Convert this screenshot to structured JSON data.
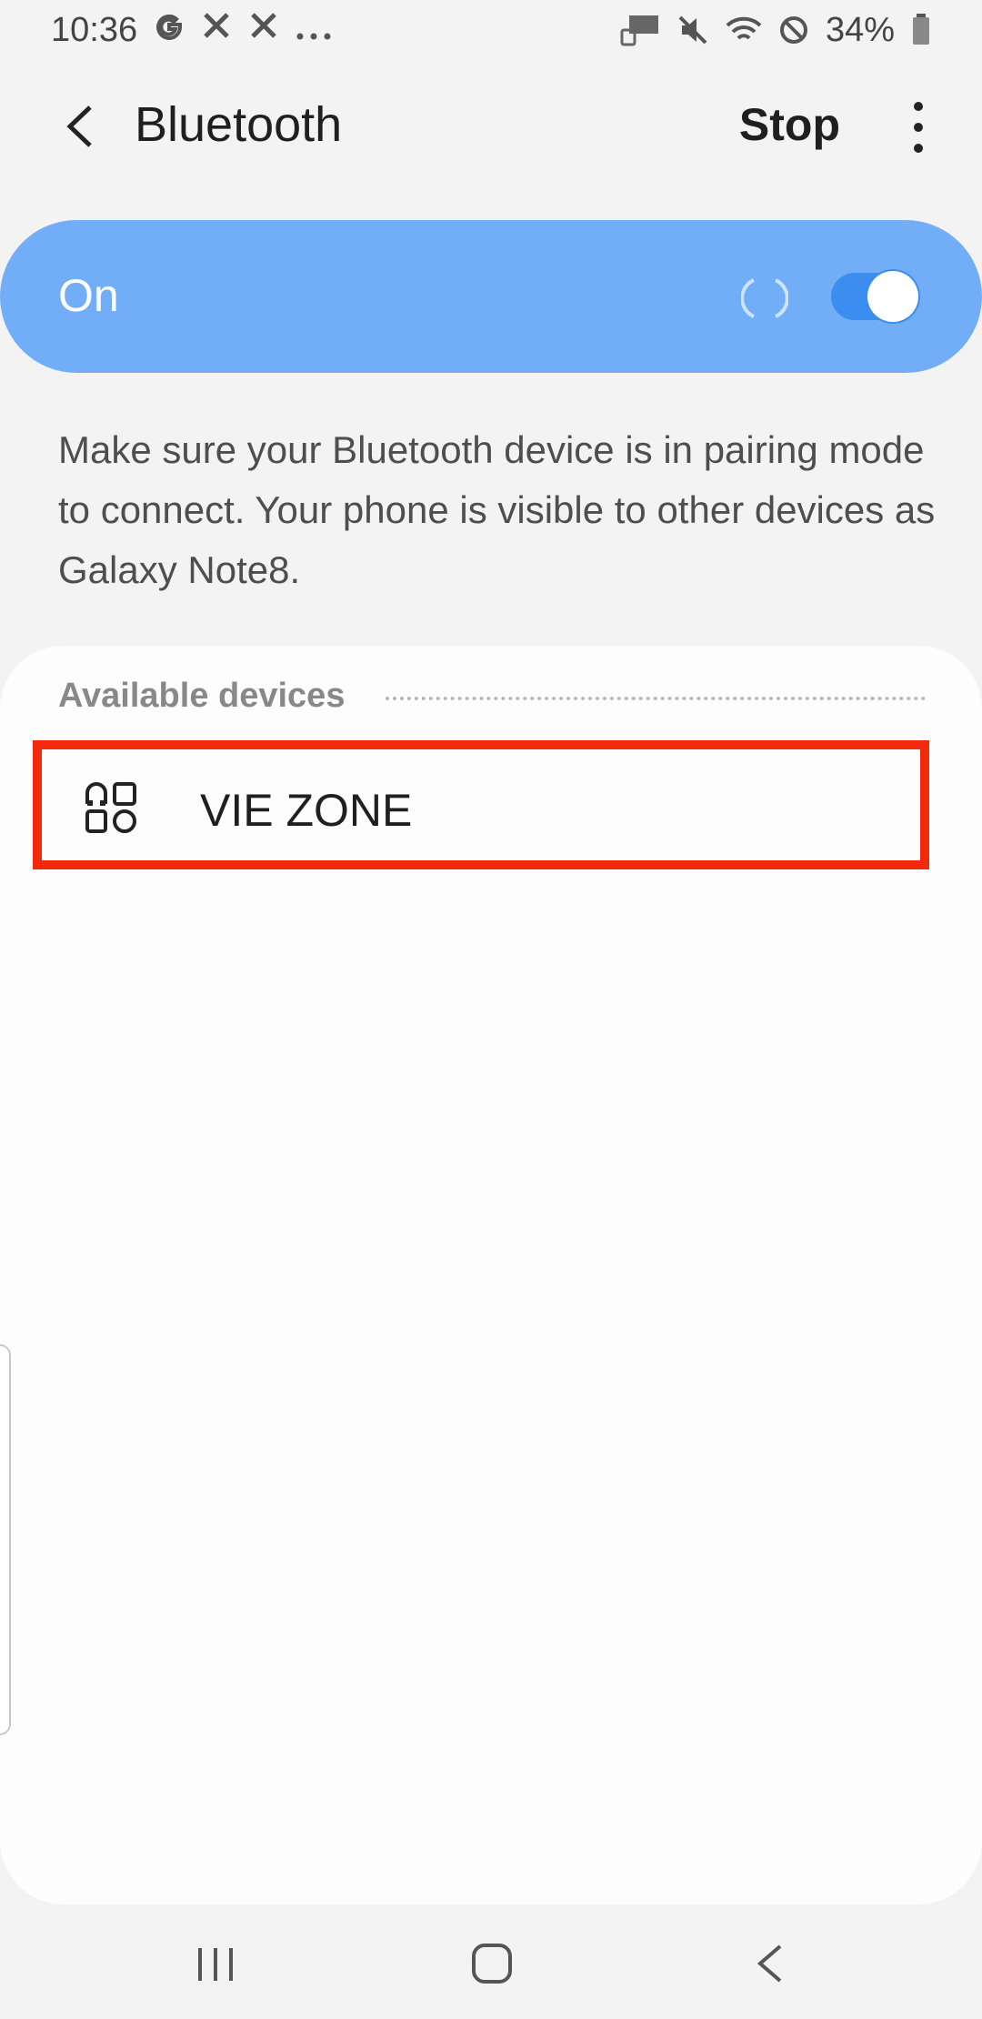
{
  "status_bar": {
    "time": "10:36",
    "left_icons": [
      "google-g-icon",
      "tools-icon",
      "tools-icon",
      "more-notifications-icon"
    ],
    "right_icons": [
      "nfc-icon",
      "mute-icon",
      "wifi-icon",
      "do-not-disturb-icon"
    ],
    "battery_percent": "34%"
  },
  "header": {
    "title": "Bluetooth",
    "stop_label": "Stop"
  },
  "toggle": {
    "label": "On",
    "state": true,
    "accent_color": "#72aef8"
  },
  "description": "Make sure your Bluetooth device is in pairing mode to connect. Your phone is visible to other devices as Galaxy Note8.",
  "available_devices": {
    "header": "Available devices",
    "items": [
      {
        "name": "VIE ZONE",
        "icon": "device-generic-icon"
      }
    ]
  },
  "highlight_color": "#f2290d",
  "nav_bar": {
    "buttons": [
      "recent-apps-icon",
      "home-icon",
      "back-icon"
    ]
  }
}
